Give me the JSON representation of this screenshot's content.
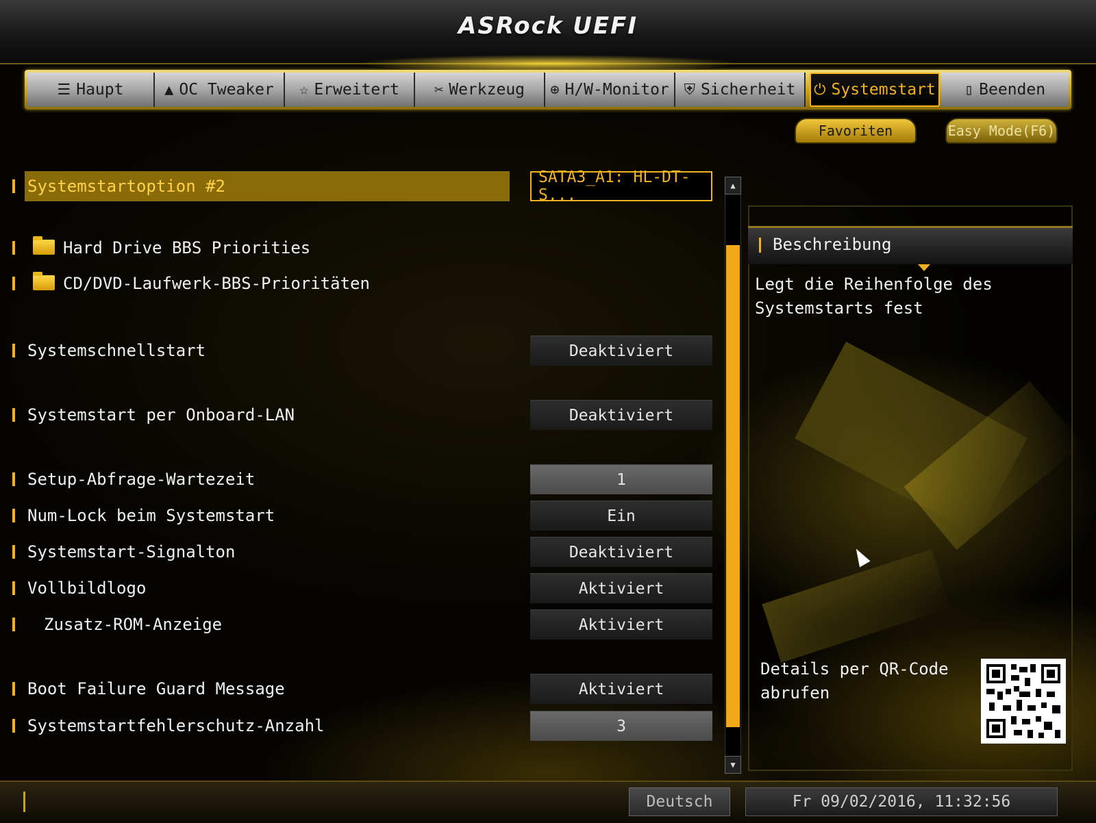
{
  "header": {
    "logo": "ASRock UEFI"
  },
  "tabs": [
    {
      "label": "Haupt",
      "icon": "list-icon",
      "glyph": "☰",
      "active": false
    },
    {
      "label": "OC Tweaker",
      "icon": "rocket-icon",
      "glyph": "🚀",
      "active": false
    },
    {
      "label": "Erweitert",
      "icon": "star-icon",
      "glyph": "☆",
      "active": false
    },
    {
      "label": "Werkzeug",
      "icon": "tools-icon",
      "glyph": "✂",
      "active": false
    },
    {
      "label": "H/W-Monitor",
      "icon": "monitor-icon",
      "glyph": "⊕",
      "active": false
    },
    {
      "label": "Sicherheit",
      "icon": "shield-icon",
      "glyph": "⛨",
      "active": false
    },
    {
      "label": "Systemstart",
      "icon": "power-icon",
      "glyph": "⏻",
      "active": true
    },
    {
      "label": "Beenden",
      "icon": "exit-icon",
      "glyph": "▯",
      "active": false
    }
  ],
  "buttons": {
    "favorites": "Favoriten",
    "easy_mode": "Easy Mode(F6)"
  },
  "settings": [
    {
      "label": "Systemstartoption #2",
      "value": "SATA3_A1: HL-DT-S...",
      "selected": true
    },
    {
      "label": "Hard Drive BBS Priorities",
      "folder": true
    },
    {
      "label": "CD/DVD-Laufwerk-BBS-Prioritäten",
      "folder": true
    },
    {
      "label": "Systemschnellstart",
      "value": "Deaktiviert"
    },
    {
      "label": "Systemstart per Onboard-LAN",
      "value": "Deaktiviert"
    },
    {
      "label": "Setup-Abfrage-Wartezeit",
      "value": "1",
      "numeric": true
    },
    {
      "label": "Num-Lock beim Systemstart",
      "value": "Ein"
    },
    {
      "label": "Systemstart-Signalton",
      "value": "Deaktiviert"
    },
    {
      "label": "Vollbildlogo",
      "value": "Aktiviert"
    },
    {
      "label": "Zusatz-ROM-Anzeige",
      "value": "Aktiviert",
      "indent": true
    },
    {
      "label": "Boot Failure Guard Message",
      "value": "Aktiviert"
    },
    {
      "label": "Systemstartfehlerschutz-Anzahl",
      "value": "3",
      "numeric": true
    }
  ],
  "description": {
    "title": "Beschreibung",
    "text": "Legt die Reihenfolge des Systemstarts fest",
    "qr_text": "Details per QR-Code abrufen"
  },
  "footer": {
    "language": "Deutsch",
    "datetime": "Fr 09/02/2016, 11:32:56"
  },
  "colors": {
    "accent": "#f3b21e",
    "highlight_row": "#8a6b0a"
  }
}
